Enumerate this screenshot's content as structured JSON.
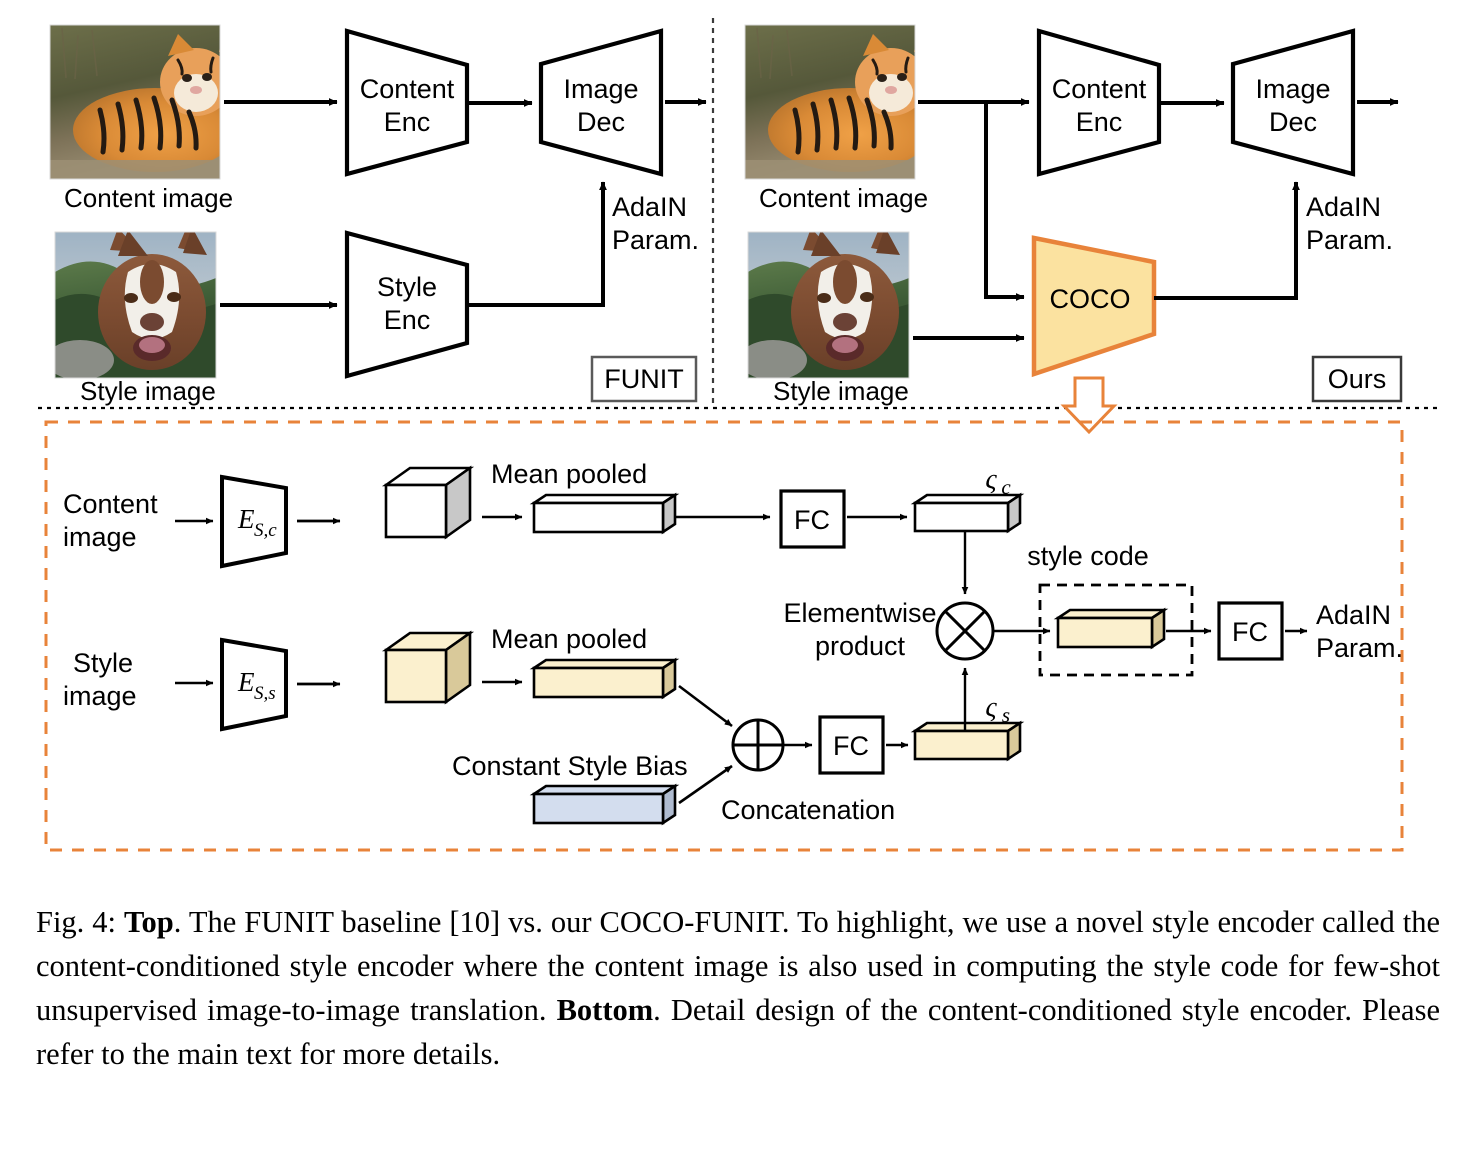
{
  "figure": {
    "top_left_panel": {
      "tag": "FUNIT",
      "content_image_label": "Content image",
      "style_image_label": "Style image",
      "content_encoder": [
        "Content",
        "Enc"
      ],
      "style_encoder": [
        "Style",
        "Enc"
      ],
      "image_decoder": [
        "Image",
        "Dec"
      ],
      "adain_label": [
        "AdaIN",
        "Param."
      ]
    },
    "top_right_panel": {
      "tag": "Ours",
      "content_image_label": "Content image",
      "style_image_label": "Style image",
      "content_encoder": [
        "Content",
        "Enc"
      ],
      "coco_module": "COCO",
      "image_decoder": [
        "Image",
        "Dec"
      ],
      "adain_label": [
        "AdaIN",
        "Param."
      ]
    },
    "bottom_panel": {
      "content_image_label": [
        "Content",
        "image"
      ],
      "style_image_label": [
        "Style",
        "image"
      ],
      "content_encoder_symbol": "E",
      "content_encoder_sub": "S,c",
      "style_encoder_symbol": "E",
      "style_encoder_sub": "S,s",
      "mean_pooled_content": "Mean pooled",
      "mean_pooled_style": "Mean pooled",
      "constant_style_bias": "Constant Style Bias",
      "concatenation": "Concatenation",
      "elementwise_product": [
        "Elementwise",
        "product"
      ],
      "fc_content": "FC",
      "fc_style": "FC",
      "fc_output": "FC",
      "zeta_c": "ς",
      "zeta_c_sub": "c",
      "zeta_s": "ς",
      "zeta_s_sub": "s",
      "style_code_label": "style code",
      "adain_label": [
        "AdaIN",
        "Param."
      ]
    },
    "colors": {
      "accent_orange": "#E8833A",
      "coco_fill": "#FBE2A0",
      "cream_fill": "#FBF0CE",
      "cream_side": "#D9C99A",
      "blue_fill": "#D3DDEE",
      "blue_side": "#AFBBD0",
      "gray_side": "#C8C8C8",
      "stroke": "#000000"
    }
  },
  "caption": {
    "prefix": "Fig. 4: ",
    "bold1": "Top",
    "text1": ". The FUNIT baseline [10] vs. our COCO-FUNIT. To highlight, we use a novel style encoder called the content-conditioned style encoder where the content image is also used in computing the style code for few-shot unsupervised image-to-image translation. ",
    "bold2": "Bottom",
    "text2": ". Detail design of the content-conditioned style encoder. Please refer to the main text for more details."
  }
}
